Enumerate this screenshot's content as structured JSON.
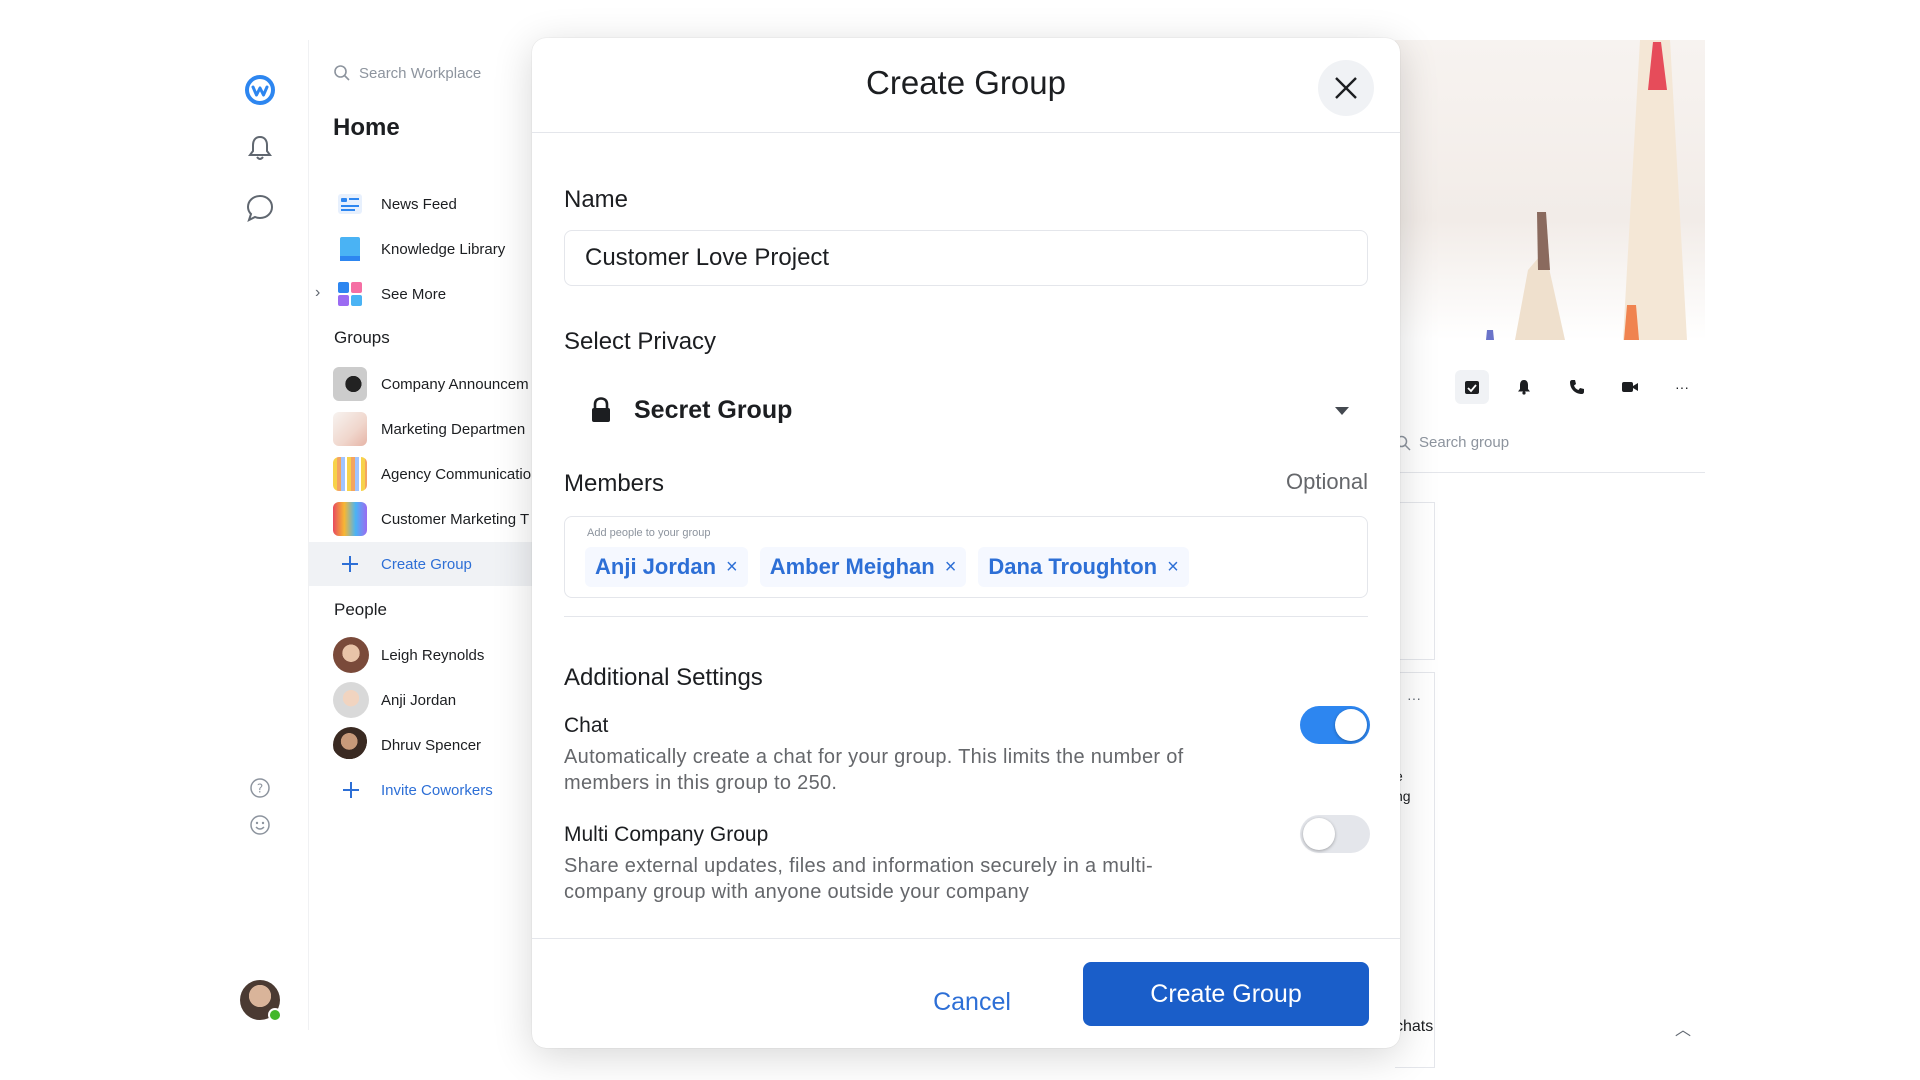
{
  "colors": {
    "accent": "#2d6fd6",
    "toggle_on": "#2d86f0",
    "primary_button": "#1a5ec9",
    "online_status": "#42b72a"
  },
  "rail": {
    "icons": [
      "workplace-logo-icon",
      "bell-icon",
      "chat-bubble-icon",
      "help-icon",
      "smiley-icon",
      "user-avatar"
    ]
  },
  "nav": {
    "search_placeholder": "Search Workplace",
    "home_title": "Home",
    "items": [
      {
        "label": "News Feed",
        "icon": "news-feed-icon"
      },
      {
        "label": "Knowledge Library",
        "icon": "book-icon"
      },
      {
        "label": "See More",
        "icon": "apps-icon"
      }
    ],
    "groups_title": "Groups",
    "groups": [
      {
        "label": "Company Announcem"
      },
      {
        "label": "Marketing Departmen"
      },
      {
        "label": "Agency Communicatio"
      },
      {
        "label": "Customer Marketing T"
      },
      {
        "label": "Create Group"
      }
    ],
    "people_title": "People",
    "people": [
      {
        "label": "Leigh Reynolds"
      },
      {
        "label": "Anji Jordan"
      },
      {
        "label": "Dhruv Spencer"
      },
      {
        "label": "Invite Coworkers"
      }
    ]
  },
  "right_panel": {
    "search_placeholder": "Search group",
    "menu_text": "···",
    "fragment_1": "e",
    "fragment_2": "ng",
    "bottom_text": "chats"
  },
  "modal": {
    "title": "Create Group",
    "name_label": "Name",
    "name_value": "Customer Love Project",
    "privacy_label": "Select Privacy",
    "privacy_value": "Secret Group",
    "members_label": "Members",
    "members_optional": "Optional",
    "members_hint": "Add people to your group",
    "members": [
      "Anji Jordan",
      "Amber Meighan",
      "Dana Troughton"
    ],
    "chip_remove": "×",
    "additional_title": "Additional Settings",
    "chat_title": "Chat",
    "chat_desc": "Automatically create a chat for your group. This limits the number of members in this group to 250.",
    "chat_enabled": true,
    "multi_title": "Multi Company Group",
    "multi_desc": "Share external updates, files and information securely in a multi-company group with anyone outside your company",
    "multi_enabled": false,
    "cancel_label": "Cancel",
    "create_label": "Create Group"
  }
}
